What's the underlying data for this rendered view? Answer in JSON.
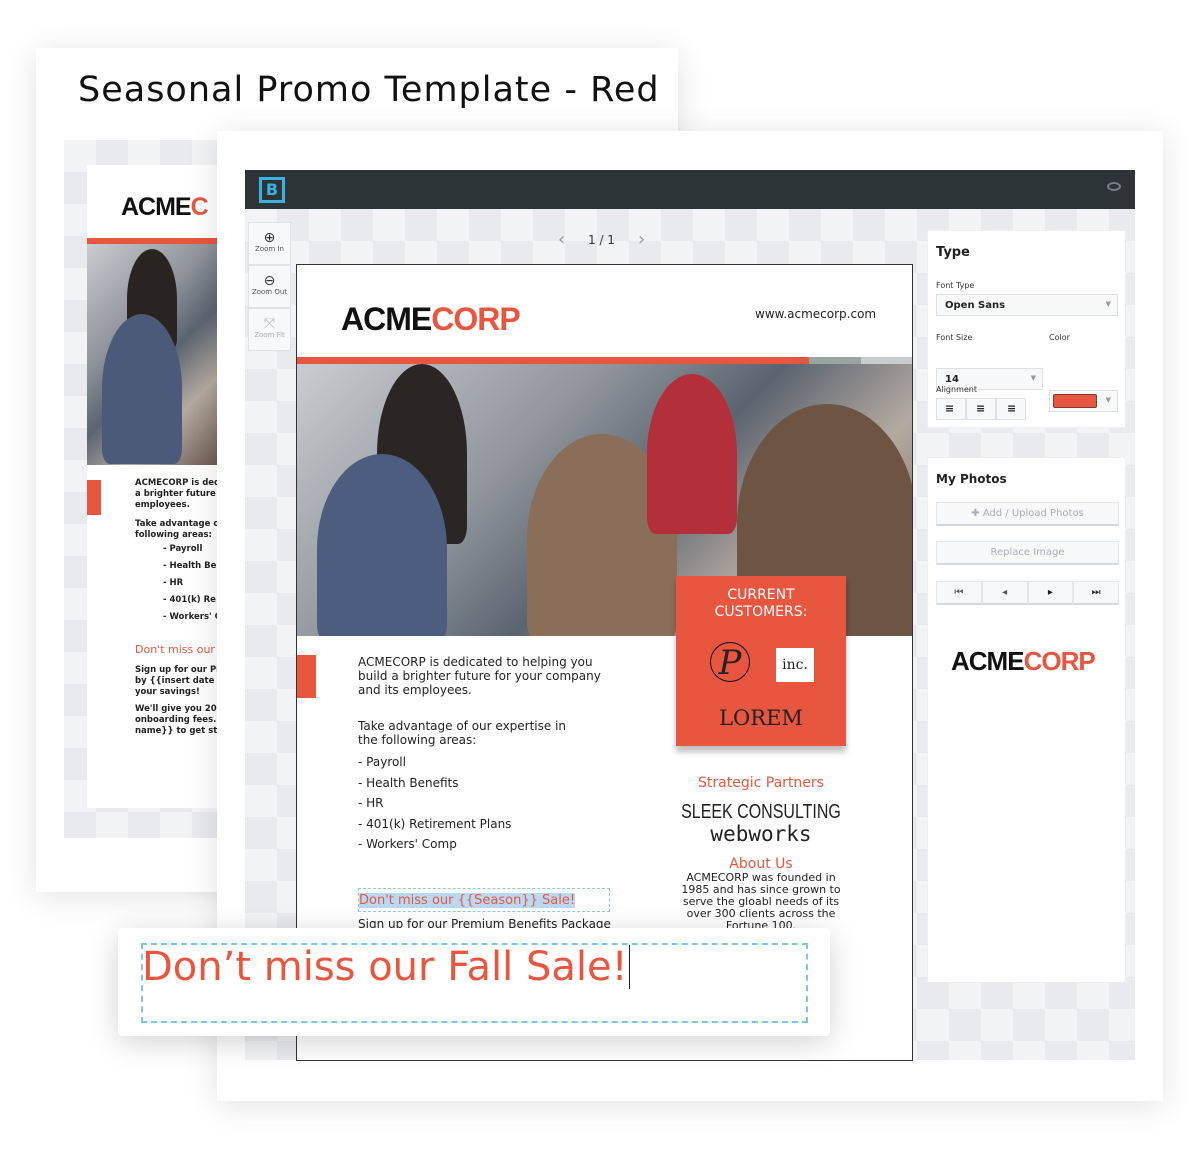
{
  "title": "Seasonal Promo Template - Red",
  "colors": {
    "accent": "#e8563f",
    "topbar": "#2c3437",
    "logo_blue": "#3bb3e0"
  },
  "back_preview": {
    "logo_black": "ACME",
    "logo_red": "C",
    "lines": [
      "ACMECORP is ded",
      "a brighter future f",
      "employees."
    ],
    "lines2": [
      "Take advantage of",
      "following areas:"
    ],
    "items": [
      "- Payroll",
      "- Health Be",
      "- HR",
      "- 401(k) Re",
      "- Workers' C"
    ],
    "promo": "Don't miss our",
    "lines3": [
      "Sign up for our Pr",
      "by {{insert date an",
      "your savings!"
    ],
    "lines4": [
      "We'll give you 20%",
      "onboarding fees. J",
      "name}} to get star"
    ]
  },
  "editor": {
    "app_logo": "B",
    "topbar_icon": "eye-icon",
    "zoom_tools": [
      {
        "label": "Zoom In",
        "icon": "zoom-in-icon"
      },
      {
        "label": "Zoom Out",
        "icon": "zoom-out-icon"
      },
      {
        "label": "Zoom Fit",
        "icon": "zoom-fit-icon"
      }
    ],
    "pager": "1 / 1",
    "document": {
      "logo_black": "ACME",
      "logo_red": "CORP",
      "url": "www.acmecorp.com",
      "intro": "ACMECORP is dedicated to helping you build a brighter future for your company and its employees.",
      "expertise": "Take advantage of our expertise in the following areas:",
      "items": [
        "- Payroll",
        "- Health Benefits",
        "- HR",
        "- 401(k) Retirement Plans",
        "- Workers' Comp"
      ],
      "promo_template": "Don't miss our {{Season}} Sale!",
      "signup": "Sign up for our Premium Benefits Package",
      "customers_title": "CURRENT CUSTOMERS:",
      "customer_logos": [
        "P",
        "inc.",
        "LOREM"
      ],
      "partners_title": "Strategic Partners",
      "partners": [
        "SLEEK CONSULTING",
        "webworks"
      ],
      "about_title": "About Us",
      "about_text": "ACMECORP was founded in 1985 and has since grown to serve the gloabl needs of its over 300 clients across the Fortune 100."
    },
    "type_panel": {
      "title": "Type",
      "font_type_label": "Font Type",
      "font_type": "Open Sans",
      "font_size_label": "Font Size",
      "font_size": "14",
      "color_label": "Color",
      "color_value": "#e8563f",
      "alignment_label": "Alignment",
      "alignments": [
        "align-left-icon",
        "align-center-icon",
        "align-right-icon"
      ]
    },
    "photos_panel": {
      "title": "My Photos",
      "add_label": "Add / Upload Photos",
      "replace_label": "Replace Image",
      "nav": [
        "first-icon",
        "prev-icon",
        "next-icon",
        "last-icon"
      ],
      "logo_black": "ACME",
      "logo_red": "CORP"
    }
  },
  "edit_overlay": {
    "text": "Don’t miss our Fall Sale!"
  }
}
